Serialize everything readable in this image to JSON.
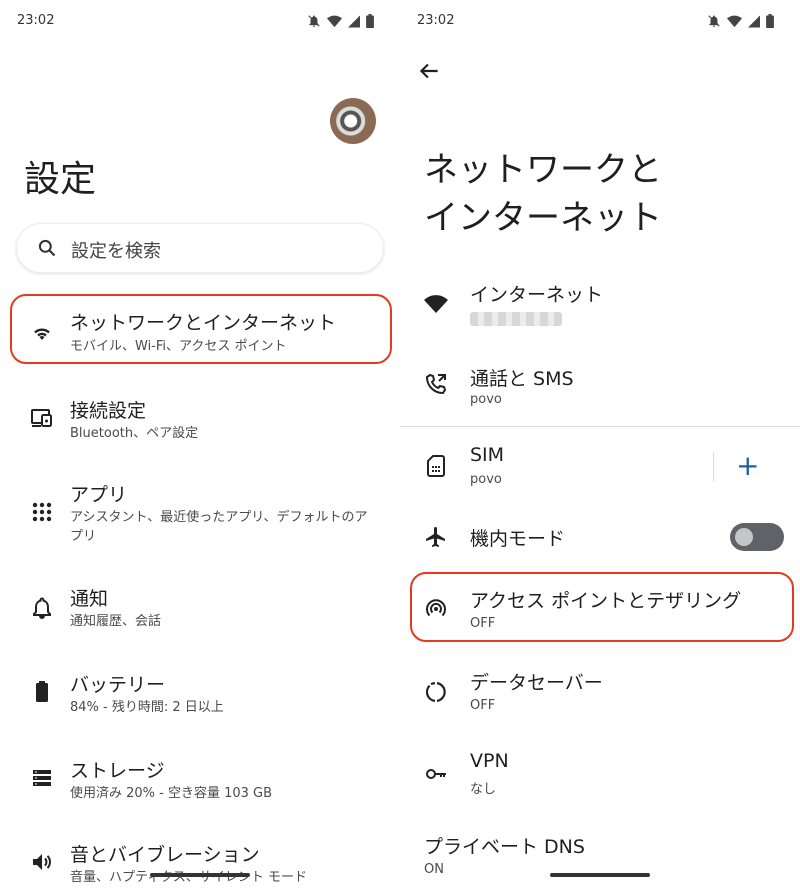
{
  "status": {
    "time": "23:02"
  },
  "left": {
    "title": "設定",
    "search": {
      "placeholder": "設定を検索"
    },
    "items": [
      {
        "title": "ネットワークとインターネット",
        "subtitle": "モバイル、Wi-Fi、アクセス ポイント",
        "icon": "wifi-icon"
      },
      {
        "title": "接続設定",
        "subtitle": "Bluetooth、ペア設定",
        "icon": "connected-devices-icon"
      },
      {
        "title": "アプリ",
        "subtitle": "アシスタント、最近使ったアプリ、デフォルトのアプリ",
        "icon": "apps-grid-icon"
      },
      {
        "title": "通知",
        "subtitle": "通知履歴、会話",
        "icon": "bell-icon"
      },
      {
        "title": "バッテリー",
        "subtitle": "84% - 残り時間: 2 日以上",
        "icon": "battery-icon"
      },
      {
        "title": "ストレージ",
        "subtitle": "使用済み 20% - 空き容量 103 GB",
        "icon": "storage-icon"
      },
      {
        "title": "音とバイブレーション",
        "subtitle": "音量、ハプティクス、サイレント モード",
        "icon": "volume-icon"
      }
    ]
  },
  "right": {
    "title_line1": "ネットワークと",
    "title_line2": "インターネット",
    "items": [
      {
        "title": "インターネット",
        "subtitle": "",
        "icon": "wifi-icon"
      },
      {
        "title": "通話と SMS",
        "subtitle": "povo",
        "icon": "phone-forward-icon"
      },
      {
        "title": "SIM",
        "subtitle": "povo",
        "icon": "sim-card-icon"
      },
      {
        "title": "機内モード",
        "subtitle": "",
        "icon": "airplane-icon",
        "toggle": false
      },
      {
        "title": "アクセス ポイントとテザリング",
        "subtitle": "OFF",
        "icon": "hotspot-icon"
      },
      {
        "title": "データセーバー",
        "subtitle": "OFF",
        "icon": "data-saver-icon"
      },
      {
        "title": "VPN",
        "subtitle": "なし",
        "icon": "vpn-key-icon"
      },
      {
        "title": "プライベート DNS",
        "subtitle": "ON",
        "icon": ""
      }
    ],
    "sim_add": "+"
  },
  "colors": {
    "highlight": "#e53a1e",
    "accent": "#1a5fa8",
    "toggle_off": "#5f6368"
  }
}
